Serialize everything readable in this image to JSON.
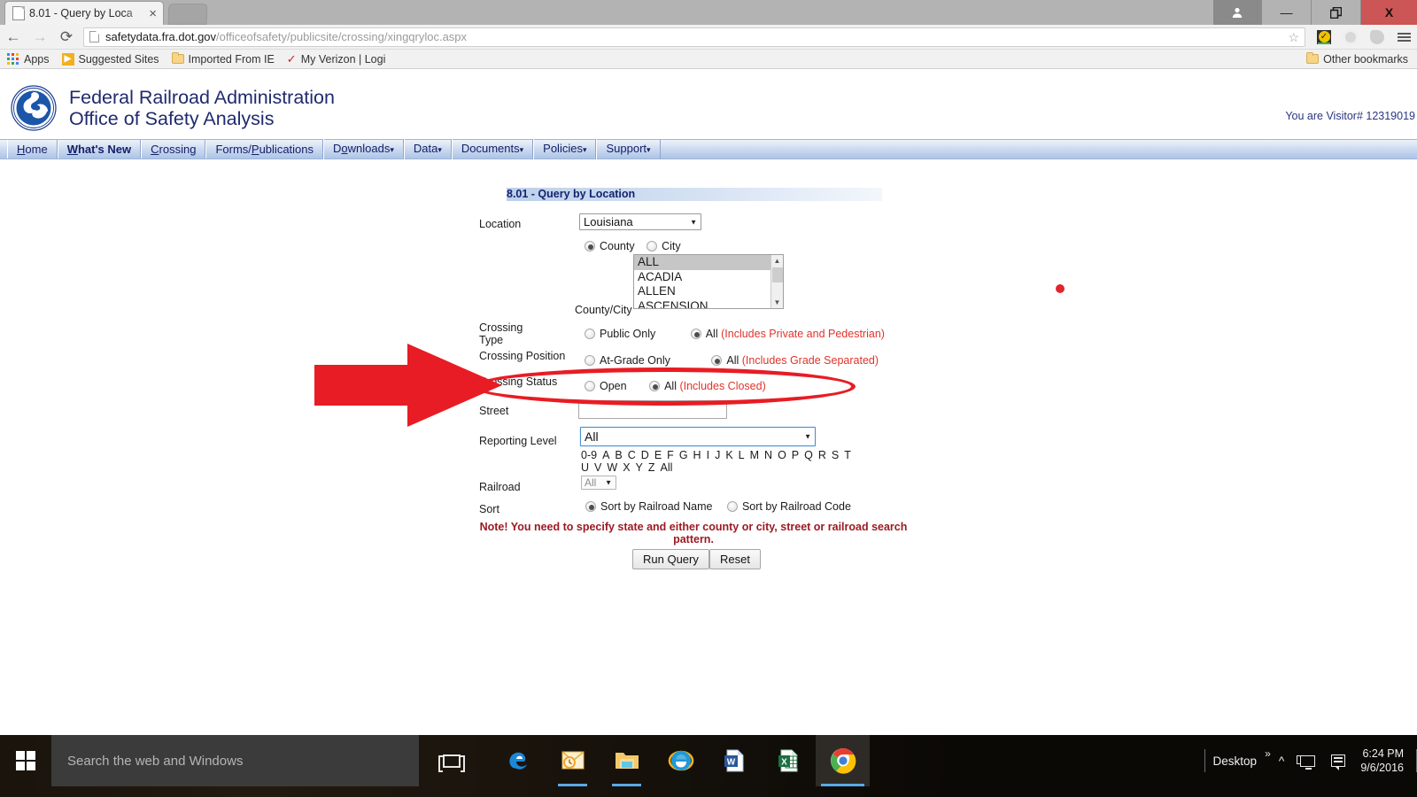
{
  "window": {
    "tab_title": "8.01 - Query by Loca",
    "tab_close": "×",
    "minimize": "—",
    "restore": "❐",
    "close": "X"
  },
  "browser": {
    "back": "←",
    "forward": "→",
    "reload": "⟳",
    "url_host": "safetydata.fra.dot.gov",
    "url_path": "/officeofsafety/publicsite/crossing/xingqryloc.aspx",
    "star": "☆",
    "bookmarks": [
      {
        "label": "Apps",
        "icon": "apps-grid-icon"
      },
      {
        "label": "Suggested Sites",
        "icon": "bing-icon"
      },
      {
        "label": "Imported From IE",
        "icon": "folder-icon"
      },
      {
        "label": "My Verizon | Logi",
        "icon": "verizon-checkmark-icon"
      }
    ],
    "other_bookmarks": "Other bookmarks"
  },
  "site": {
    "title_line1": "Federal Railroad Administration",
    "title_line2": "Office of Safety Analysis",
    "visitor": "You are Visitor# 12319019",
    "nav": [
      {
        "label": "Home",
        "accesskey": "H",
        "active": false,
        "caret": false
      },
      {
        "label": "What's New",
        "accesskey": "W",
        "active": true,
        "caret": false
      },
      {
        "label": "Crossing",
        "accesskey": "C",
        "active": false,
        "caret": false
      },
      {
        "label": "Forms/Publications",
        "accesskey": "P",
        "active": false,
        "caret": false
      },
      {
        "label": "Downloads",
        "accesskey": "o",
        "active": false,
        "caret": true
      },
      {
        "label": "Data",
        "accesskey": "",
        "active": false,
        "caret": true
      },
      {
        "label": "Documents",
        "accesskey": "",
        "active": false,
        "caret": true
      },
      {
        "label": "Policies",
        "accesskey": "",
        "active": false,
        "caret": true
      },
      {
        "label": "Support",
        "accesskey": "",
        "active": false,
        "caret": true
      }
    ]
  },
  "form": {
    "panel_title": "8.01 - Query by Location",
    "location_label": "Location",
    "state_value": "Louisiana",
    "geo_county_label": "County",
    "geo_city_label": "City",
    "geo_selected": "County",
    "county_city_label": "County/City",
    "county_options": [
      "ALL",
      "ACADIA",
      "ALLEN",
      "ASCENSION"
    ],
    "county_selected": "ALL",
    "crossing_type_label_line1": "Crossing",
    "crossing_type_label_line2": "Type",
    "crossing_type_opt1": "Public Only",
    "crossing_type_opt2": "All",
    "crossing_type_opt2_hint": "(Includes Private and Pedestrian)",
    "crossing_type_selected": "All",
    "crossing_position_label": "Crossing Position",
    "crossing_position_opt1": "At-Grade Only",
    "crossing_position_opt2": "All",
    "crossing_position_opt2_hint": "(Includes Grade Separated)",
    "crossing_position_selected": "All",
    "crossing_status_label": "Crossing Status",
    "crossing_status_opt1": "Open",
    "crossing_status_opt2": "All",
    "crossing_status_opt2_hint": "(Includes Closed)",
    "crossing_status_selected": "All",
    "street_label": "Street",
    "street_value": "",
    "reporting_level_label": "Reporting Level",
    "reporting_level_value": "All",
    "alphabet": [
      "0-9",
      "A",
      "B",
      "C",
      "D",
      "E",
      "F",
      "G",
      "H",
      "I",
      "J",
      "K",
      "L",
      "M",
      "N",
      "O",
      "P",
      "Q",
      "R",
      "S",
      "T",
      "U",
      "V",
      "W",
      "X",
      "Y",
      "Z",
      "All"
    ],
    "railroad_label": "Railroad",
    "railroad_value": "All",
    "sort_label": "Sort",
    "sort_opt1": "Sort by Railroad Name",
    "sort_opt2": "Sort by Railroad Code",
    "sort_selected": "Sort by Railroad Name",
    "note": "Note! You need to specify state and either county or city, street or railroad search pattern.",
    "run_query": "Run Query",
    "reset": "Reset"
  },
  "annotations": {
    "arrow": "red-right-arrow pointing at Crossing Status row",
    "ellipse": "red-ellipse around Crossing Status row",
    "dot": "red-dot",
    "color": "#e81c24"
  },
  "taskbar": {
    "search_placeholder": "Search the web and Windows",
    "apps": [
      {
        "name": "microsoft-edge",
        "active": false,
        "open": false
      },
      {
        "name": "outlook",
        "active": false,
        "open": true
      },
      {
        "name": "file-explorer",
        "active": false,
        "open": true
      },
      {
        "name": "internet-explorer",
        "active": false,
        "open": false
      },
      {
        "name": "microsoft-word",
        "active": false,
        "open": false
      },
      {
        "name": "microsoft-excel",
        "active": false,
        "open": false
      },
      {
        "name": "google-chrome",
        "active": true,
        "open": false
      }
    ],
    "desktop_label": "Desktop",
    "overflow": "»",
    "time": "6:24 PM",
    "date": "9/6/2016"
  }
}
